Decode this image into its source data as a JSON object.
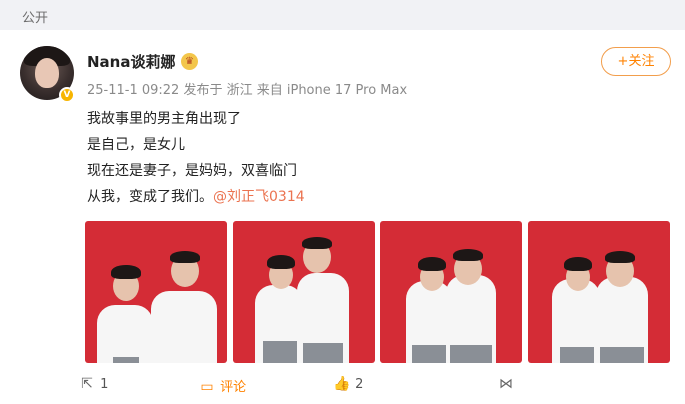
{
  "visibility": "公开",
  "post": {
    "author": "Nana谈莉娜",
    "meta": "25-11-1 09:22 发布于 浙江 来自 iPhone 17 Pro Max",
    "follow_label": "+关注",
    "vip_badge": "V",
    "lines": [
      "我故事里的男主角出现了",
      "是自己，是女儿",
      "现在还是妻子，是妈妈，双喜临门",
      "从我，变成了我们。"
    ],
    "mention": "@刘正飞0314"
  },
  "actions": {
    "share_count": "1",
    "comment_label": "评论",
    "like_count": "2"
  },
  "colors": {
    "accent": "#ff8200",
    "mention": "#eb7350",
    "photo_bg": "#d42c36"
  }
}
